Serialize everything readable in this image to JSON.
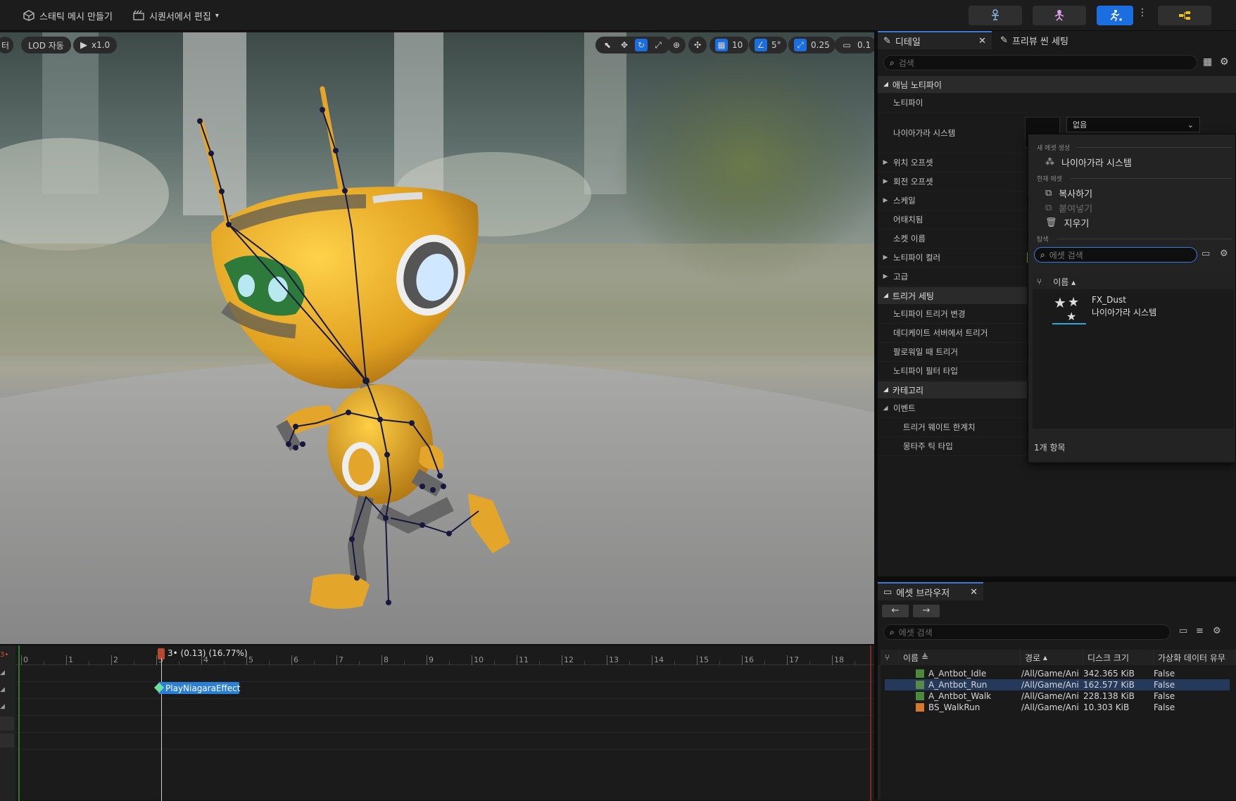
{
  "toolbar": {
    "make_static_mesh": "스태틱 메시 만들기",
    "edit_in_sequencer": "시퀀서에서 편집"
  },
  "viewport": {
    "left_partial": "터",
    "lod": "LOD 자동",
    "play_rate": "x1.0",
    "grid_snap": "10",
    "rotation_snap": "5°",
    "scale_snap": "0.25",
    "camera_speed": "0.1"
  },
  "timeline": {
    "playhead_label": "3• (0.13) (16.77%)",
    "frames": [
      "0",
      "1",
      "2",
      "3",
      "4",
      "5",
      "6",
      "7",
      "8",
      "9",
      "10",
      "11",
      "12",
      "13",
      "14",
      "15",
      "16",
      "17",
      "18"
    ],
    "notify_label": "PlayNiagaraEffect",
    "left_marker": "3•"
  },
  "details": {
    "tab_details": "디테일",
    "tab_preview": "프리뷰 씬 세팅",
    "search_placeholder": "검색",
    "section_anim_notify": "애님 노티파이",
    "prop_notify": "노티파이",
    "prop_niagara": "나이아가라 시스템",
    "niagara_value": "없음",
    "prop_loc_offset": "위치 오프셋",
    "prop_rot_offset": "회전 오프셋",
    "prop_scale": "스케일",
    "prop_attached": "어태치됨",
    "prop_socket": "소켓 이름",
    "prop_color": "노티파이 컬러",
    "prop_advanced": "고급",
    "section_trigger": "트리거 세팅",
    "prop_trigger_change": "노티파이 트리거 변경",
    "prop_dedicated": "데디케이트 서버에서 트리거",
    "prop_follower": "팔로워일 때 트리거",
    "prop_filter": "노티파이 필터 타입",
    "section_category": "카테고리",
    "section_event": "이벤트",
    "prop_weight": "트리거 웨이트 한계치",
    "prop_montage": "몽타주 틱 타입"
  },
  "dropdown": {
    "head_new": "새 에셋 생성",
    "item_niagara": "나이아가라 시스템",
    "head_current": "현재 에셋",
    "item_copy": "복사하기",
    "item_paste": "붙여넣기",
    "item_clear": "지우기",
    "head_browse": "탐색",
    "search_placeholder": "에셋 검색",
    "col_name": "이름",
    "asset_name": "FX_Dust",
    "asset_type": "나이아가라 시스템",
    "count": "1개 항목"
  },
  "assets": {
    "tab": "에셋 브라우저",
    "search_placeholder": "에셋 검색",
    "col_name": "이름",
    "col_path": "경로",
    "col_disk": "디스크 크기",
    "col_virtual": "가상화 데이터 유무",
    "rows": [
      {
        "name": "A_Antbot_Idle",
        "path": "/All/Game/Ani",
        "size": "342.365 KiB",
        "virt": "False"
      },
      {
        "name": "A_Antbot_Run",
        "path": "/All/Game/Ani",
        "size": "162.577 KiB",
        "virt": "False"
      },
      {
        "name": "A_Antbot_Walk",
        "path": "/All/Game/Ani",
        "size": "228.138 KiB",
        "virt": "False"
      },
      {
        "name": "BS_WalkRun",
        "path": "/All/Game/Ani",
        "size": "10.303 KiB",
        "virt": "False"
      }
    ]
  },
  "colors": {
    "accent": "#1a6ee0",
    "notify": "#2b7fd6",
    "robot": "#e8a825"
  }
}
